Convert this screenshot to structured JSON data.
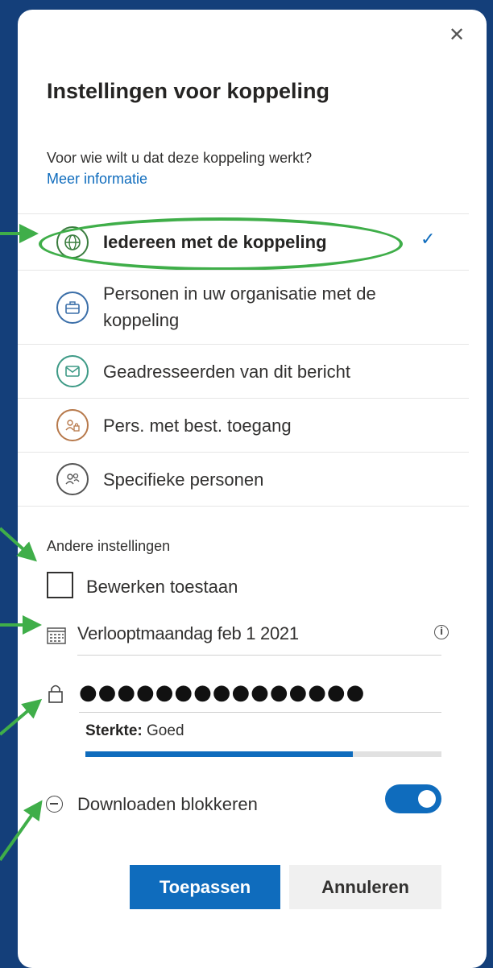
{
  "dialog": {
    "close_glyph": "✕",
    "title": "Instellingen voor koppeling",
    "question": "Voor wie wilt u dat deze koppeling werkt?",
    "more_info": "Meer informatie"
  },
  "options": [
    {
      "label": "Iedereen met de koppeling",
      "icon": "globe-icon",
      "color": "#3a7d3e",
      "selected": true
    },
    {
      "label": "Personen in uw organisatie met de koppeling",
      "icon": "briefcase-icon",
      "color": "#3a6ea8",
      "selected": false
    },
    {
      "label": "Geadresseerden van dit bericht",
      "icon": "envelope-icon",
      "color": "#3d9a86",
      "selected": false
    },
    {
      "label": "Pers. met best. toegang",
      "icon": "people-lock-icon",
      "color": "#b7794b",
      "selected": false
    },
    {
      "label": "Specifieke personen",
      "icon": "people-icon",
      "color": "#555555",
      "selected": false
    }
  ],
  "selected_check": "✓",
  "other": {
    "title": "Andere instellingen",
    "allow_edit_label": "Bewerken toestaan",
    "allow_edit_checked": false,
    "expiry_label": "Verloopt",
    "expiry_value": "maandag feb 1 2021",
    "info_glyph": "i",
    "password_mask": "●●●●●●●●●●●●●●●",
    "strength_label": "Sterkte:",
    "strength_value": "Goed",
    "strength_fraction": 0.75,
    "block_download_label": "Downloaden blokkeren",
    "block_download_on": true
  },
  "buttons": {
    "apply": "Toepassen",
    "cancel": "Annuleren"
  },
  "colors": {
    "background": "#143f7a",
    "accent": "#0f6cbd",
    "annotation_green": "#3fae49"
  }
}
